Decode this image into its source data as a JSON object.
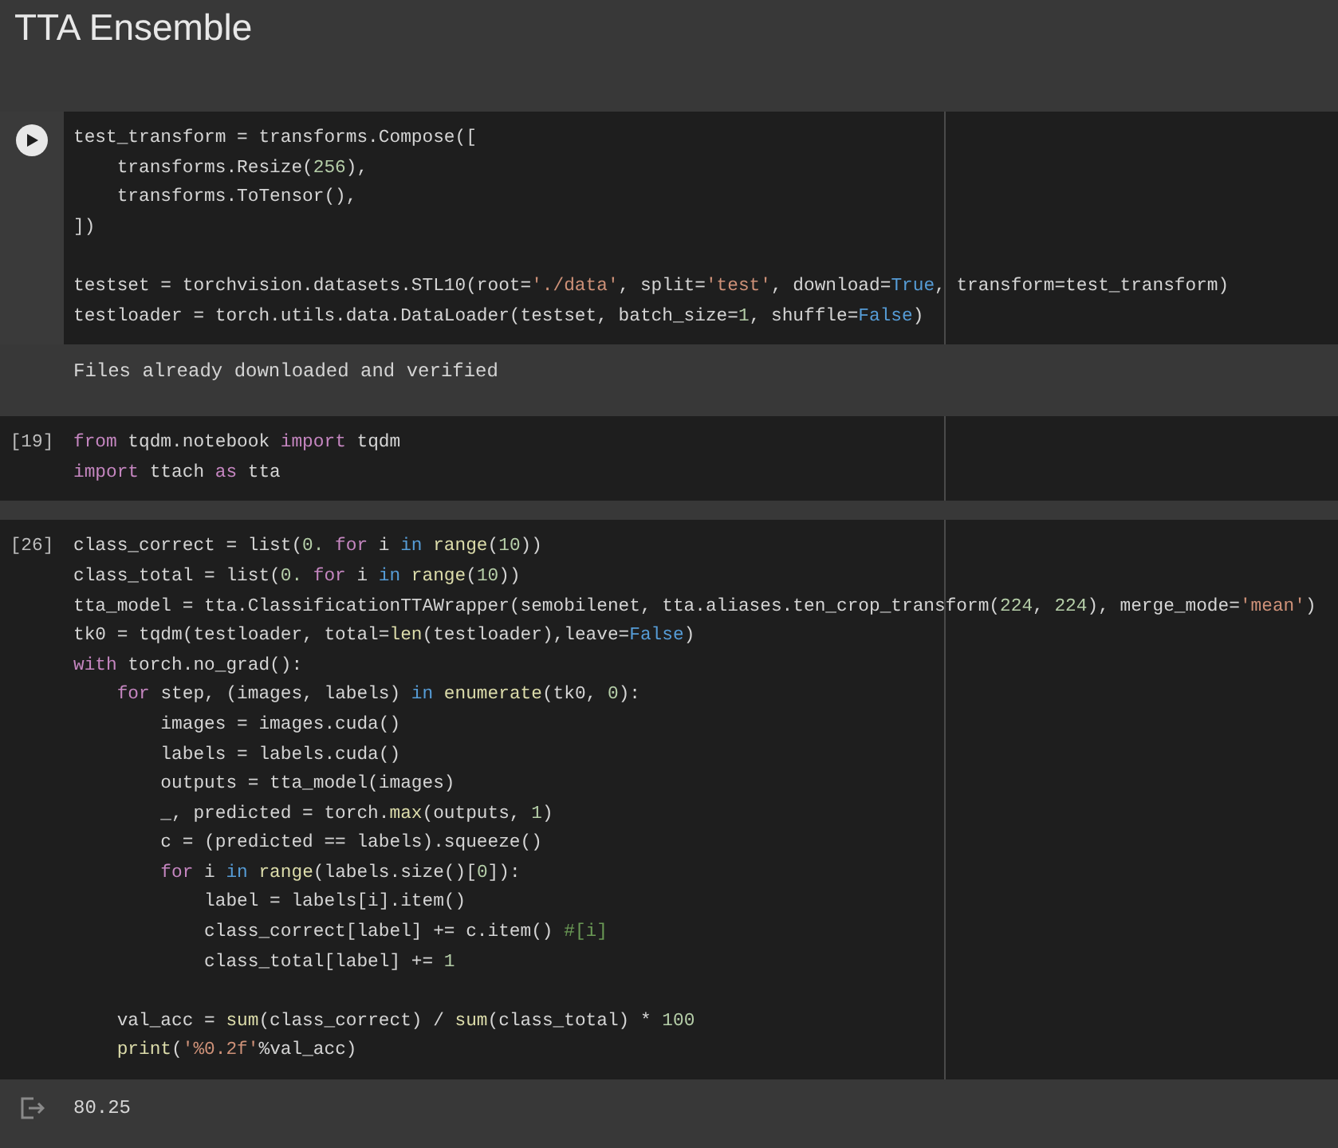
{
  "title": "TTA Ensemble",
  "cells": [
    {
      "kind": "run",
      "focused": true,
      "lines": [
        {
          "kind": "code",
          "tokens": [
            {
              "t": "test_transform = transforms.Compose([",
              "kind": "plain"
            }
          ]
        },
        {
          "kind": "code",
          "tokens": [
            {
              "t": "    transforms.Resize(",
              "kind": "plain"
            },
            {
              "t": "256",
              "kind": "number"
            },
            {
              "t": "),",
              "kind": "plain"
            }
          ]
        },
        {
          "kind": "code",
          "tokens": [
            {
              "t": "    transforms.ToTensor(),",
              "kind": "plain"
            }
          ]
        },
        {
          "kind": "code",
          "tokens": [
            {
              "t": "])",
              "kind": "plain"
            }
          ]
        },
        {
          "kind": "blank"
        },
        {
          "kind": "code",
          "tokens": [
            {
              "t": "testset = torchvision.datasets.STL10(root=",
              "kind": "plain"
            },
            {
              "t": "'./data'",
              "kind": "string"
            },
            {
              "t": ", split=",
              "kind": "plain"
            },
            {
              "t": "'test'",
              "kind": "string"
            },
            {
              "t": ", download=",
              "kind": "plain"
            },
            {
              "t": "True",
              "kind": "builtin"
            },
            {
              "t": ", transform=test_transform)",
              "kind": "plain"
            }
          ]
        },
        {
          "kind": "code",
          "tokens": [
            {
              "t": "testloader = torch.utils.data.DataLoader(testset, batch_size=",
              "kind": "plain"
            },
            {
              "t": "1",
              "kind": "number"
            },
            {
              "t": ", shuffle=",
              "kind": "plain"
            },
            {
              "t": "False",
              "kind": "builtin"
            },
            {
              "t": ")",
              "kind": "plain"
            }
          ]
        }
      ],
      "output": {
        "kind": "text",
        "text": "Files already downloaded and verified"
      }
    },
    {
      "kind": "count",
      "count": "[19]",
      "focused": false,
      "lines": [
        {
          "kind": "code",
          "tokens": [
            {
              "t": "from",
              "kind": "keyword"
            },
            {
              "t": " tqdm.notebook ",
              "kind": "plain"
            },
            {
              "t": "import",
              "kind": "keyword"
            },
            {
              "t": " tqdm",
              "kind": "plain"
            }
          ]
        },
        {
          "kind": "code",
          "tokens": [
            {
              "t": "import",
              "kind": "keyword"
            },
            {
              "t": " ttach ",
              "kind": "plain"
            },
            {
              "t": "as",
              "kind": "keyword"
            },
            {
              "t": " tta",
              "kind": "plain"
            }
          ]
        }
      ]
    },
    {
      "kind": "count",
      "count": "[26]",
      "focused": false,
      "lines": [
        {
          "kind": "code",
          "tokens": [
            {
              "t": "class_correct = list(",
              "kind": "plain"
            },
            {
              "t": "0.",
              "kind": "number"
            },
            {
              "t": " for",
              "kind": "keyword"
            },
            {
              "t": " i ",
              "kind": "plain"
            },
            {
              "t": "in",
              "kind": "builtin"
            },
            {
              "t": " range",
              "kind": "func"
            },
            {
              "t": "(",
              "kind": "plain"
            },
            {
              "t": "10",
              "kind": "number"
            },
            {
              "t": "))",
              "kind": "plain"
            }
          ]
        },
        {
          "kind": "code",
          "tokens": [
            {
              "t": "class_total = list(",
              "kind": "plain"
            },
            {
              "t": "0.",
              "kind": "number"
            },
            {
              "t": " for",
              "kind": "keyword"
            },
            {
              "t": " i ",
              "kind": "plain"
            },
            {
              "t": "in",
              "kind": "builtin"
            },
            {
              "t": " range",
              "kind": "func"
            },
            {
              "t": "(",
              "kind": "plain"
            },
            {
              "t": "10",
              "kind": "number"
            },
            {
              "t": "))",
              "kind": "plain"
            }
          ]
        },
        {
          "kind": "code",
          "tokens": [
            {
              "t": "tta_model = tta.ClassificationTTAWrapper(semobilenet, tta.aliases.ten_crop_transform(",
              "kind": "plain"
            },
            {
              "t": "224",
              "kind": "number"
            },
            {
              "t": ", ",
              "kind": "plain"
            },
            {
              "t": "224",
              "kind": "number"
            },
            {
              "t": "), merge_mode=",
              "kind": "plain"
            },
            {
              "t": "'mean'",
              "kind": "string"
            },
            {
              "t": ")",
              "kind": "plain"
            }
          ]
        },
        {
          "kind": "code",
          "tokens": [
            {
              "t": "tk0 = tqdm(testloader, total=",
              "kind": "plain"
            },
            {
              "t": "len",
              "kind": "func"
            },
            {
              "t": "(testloader),leave=",
              "kind": "plain"
            },
            {
              "t": "False",
              "kind": "builtin"
            },
            {
              "t": ")",
              "kind": "plain"
            }
          ]
        },
        {
          "kind": "code",
          "tokens": [
            {
              "t": "with",
              "kind": "keyword"
            },
            {
              "t": " torch.no_grad():",
              "kind": "plain"
            }
          ]
        },
        {
          "kind": "code",
          "tokens": [
            {
              "t": "    for",
              "kind": "keyword"
            },
            {
              "t": " step, (images, labels) ",
              "kind": "plain"
            },
            {
              "t": "in",
              "kind": "builtin"
            },
            {
              "t": " enumerate",
              "kind": "func"
            },
            {
              "t": "(tk0, ",
              "kind": "plain"
            },
            {
              "t": "0",
              "kind": "number"
            },
            {
              "t": "):",
              "kind": "plain"
            }
          ]
        },
        {
          "kind": "code",
          "tokens": [
            {
              "t": "        images = images.cuda()",
              "kind": "plain"
            }
          ]
        },
        {
          "kind": "code",
          "tokens": [
            {
              "t": "        labels = labels.cuda()",
              "kind": "plain"
            }
          ]
        },
        {
          "kind": "code",
          "tokens": [
            {
              "t": "        outputs = tta_model(images)",
              "kind": "plain"
            }
          ]
        },
        {
          "kind": "code",
          "tokens": [
            {
              "t": "        _, predicted = torch.",
              "kind": "plain"
            },
            {
              "t": "max",
              "kind": "func"
            },
            {
              "t": "(outputs, ",
              "kind": "plain"
            },
            {
              "t": "1",
              "kind": "number"
            },
            {
              "t": ")",
              "kind": "plain"
            }
          ]
        },
        {
          "kind": "code",
          "tokens": [
            {
              "t": "        c = (predicted == labels).squeeze()",
              "kind": "plain"
            }
          ]
        },
        {
          "kind": "code",
          "tokens": [
            {
              "t": "        for",
              "kind": "keyword"
            },
            {
              "t": " i ",
              "kind": "plain"
            },
            {
              "t": "in",
              "kind": "builtin"
            },
            {
              "t": " range",
              "kind": "func"
            },
            {
              "t": "(labels.size()[",
              "kind": "plain"
            },
            {
              "t": "0",
              "kind": "number"
            },
            {
              "t": "]):",
              "kind": "plain"
            }
          ]
        },
        {
          "kind": "code",
          "tokens": [
            {
              "t": "            label = labels[i].item()",
              "kind": "plain"
            }
          ]
        },
        {
          "kind": "code",
          "tokens": [
            {
              "t": "            class_correct[label] += c.item() ",
              "kind": "plain"
            },
            {
              "t": "#[i]",
              "kind": "comment"
            }
          ]
        },
        {
          "kind": "code",
          "tokens": [
            {
              "t": "            class_total[label] += ",
              "kind": "plain"
            },
            {
              "t": "1",
              "kind": "number"
            }
          ]
        },
        {
          "kind": "blank"
        },
        {
          "kind": "code",
          "tokens": [
            {
              "t": "    val_acc = ",
              "kind": "plain"
            },
            {
              "t": "sum",
              "kind": "func"
            },
            {
              "t": "(class_correct) / ",
              "kind": "plain"
            },
            {
              "t": "sum",
              "kind": "func"
            },
            {
              "t": "(class_total) * ",
              "kind": "plain"
            },
            {
              "t": "100",
              "kind": "number"
            }
          ]
        },
        {
          "kind": "code",
          "tokens": [
            {
              "t": "    print",
              "kind": "func"
            },
            {
              "t": "(",
              "kind": "plain"
            },
            {
              "t": "'%0.2f'",
              "kind": "string"
            },
            {
              "t": "%val_acc)",
              "kind": "plain"
            }
          ]
        }
      ],
      "output": {
        "kind": "result",
        "text": "80.25"
      }
    }
  ]
}
